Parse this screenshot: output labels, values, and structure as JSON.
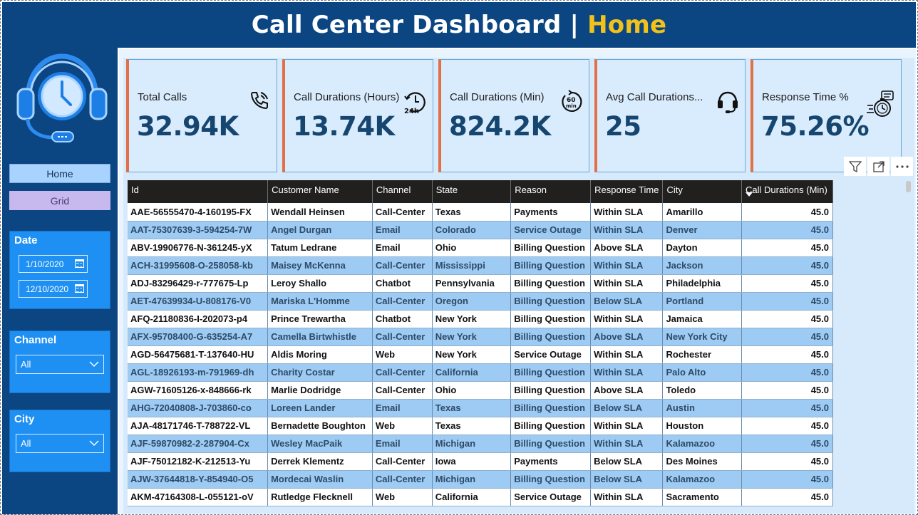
{
  "header": {
    "title": "Call Center Dashboard | ",
    "highlight": "Home"
  },
  "sidebar": {
    "logo_icon": "headset-clock-icon",
    "nav": [
      {
        "label": "Home",
        "active": true
      },
      {
        "label": "Grid",
        "active": false
      }
    ],
    "date_slicer": {
      "label": "Date",
      "start": "1/10/2020",
      "end": "12/10/2020"
    },
    "channel_slicer": {
      "label": "Channel",
      "value": "All"
    },
    "city_slicer": {
      "label": "City",
      "value": "All"
    }
  },
  "kpis": [
    {
      "label": "Total Calls",
      "value": "32.94K",
      "icon": "phone-ringing-icon"
    },
    {
      "label": "Call Durations (Hours)",
      "value": "13.74K",
      "icon": "24h-clock-icon"
    },
    {
      "label": "Call Durations (Min)",
      "value": "824.2K",
      "icon": "60-min-timer-icon"
    },
    {
      "label": "Avg Call Durations...",
      "value": "25",
      "icon": "headset-icon"
    },
    {
      "label": "Response Time %",
      "value": "75.26%",
      "icon": "fast-stopwatch-icon"
    }
  ],
  "toolbar": {
    "icons": [
      "filter-icon",
      "focus-mode-icon",
      "more-options-icon"
    ]
  },
  "colors": {
    "header_bg": "#0b4682",
    "accent": "#f2c21b",
    "card_border": "#e07048",
    "kpi_value": "#16466f"
  },
  "table": {
    "columns": [
      "Id",
      "Customer Name",
      "Channel",
      "State",
      "Reason",
      "Response Time",
      "City",
      "Call Durations (Min)"
    ],
    "sort_column": "Call Durations (Min)",
    "rows": [
      [
        "AAE-56555470-4-160195-FX",
        "Wendall Heinsen",
        "Call-Center",
        "Texas",
        "Payments",
        "Within SLA",
        "Amarillo",
        "45.0"
      ],
      [
        "AAT-75307639-3-594254-7W",
        "Angel Durgan",
        "Email",
        "Colorado",
        "Service Outage",
        "Within SLA",
        "Denver",
        "45.0"
      ],
      [
        "ABV-19906776-N-361245-yX",
        "Tatum Ledrane",
        "Email",
        "Ohio",
        "Billing Question",
        "Above SLA",
        "Dayton",
        "45.0"
      ],
      [
        "ACH-31995608-O-258058-kb",
        "Maisey McKenna",
        "Call-Center",
        "Mississippi",
        "Billing Question",
        "Within SLA",
        "Jackson",
        "45.0"
      ],
      [
        "ADJ-83296429-r-777675-Lp",
        "Leroy Shallo",
        "Chatbot",
        "Pennsylvania",
        "Billing Question",
        "Within SLA",
        "Philadelphia",
        "45.0"
      ],
      [
        "AET-47639934-U-808176-V0",
        "Mariska L'Homme",
        "Call-Center",
        "Oregon",
        "Billing Question",
        "Below SLA",
        "Portland",
        "45.0"
      ],
      [
        "AFQ-21180836-I-202073-p4",
        "Prince Trewartha",
        "Chatbot",
        "New York",
        "Billing Question",
        "Within SLA",
        "Jamaica",
        "45.0"
      ],
      [
        "AFX-95708400-G-635254-A7",
        "Camella Birtwhistle",
        "Call-Center",
        "New York",
        "Billing Question",
        "Above SLA",
        "New York City",
        "45.0"
      ],
      [
        "AGD-56475681-T-137640-HU",
        "Aldis Moring",
        "Web",
        "New York",
        "Service Outage",
        "Within SLA",
        "Rochester",
        "45.0"
      ],
      [
        "AGL-18926193-m-791969-dh",
        "Charity Costar",
        "Call-Center",
        "California",
        "Billing Question",
        "Within SLA",
        "Palo Alto",
        "45.0"
      ],
      [
        "AGW-71605126-x-848666-rk",
        "Marlie Dodridge",
        "Call-Center",
        "Ohio",
        "Billing Question",
        "Above SLA",
        "Toledo",
        "45.0"
      ],
      [
        "AHG-72040808-J-703860-co",
        "Loreen Lander",
        "Email",
        "Texas",
        "Billing Question",
        "Below SLA",
        "Austin",
        "45.0"
      ],
      [
        "AJA-48171746-T-788722-VL",
        "Bernadette Boughton",
        "Web",
        "Texas",
        "Billing Question",
        "Within SLA",
        "Houston",
        "45.0"
      ],
      [
        "AJF-59870982-2-287904-Cx",
        "Wesley MacPaik",
        "Email",
        "Michigan",
        "Billing Question",
        "Within SLA",
        "Kalamazoo",
        "45.0"
      ],
      [
        "AJF-75012182-K-212513-Yu",
        "Derrek Klementz",
        "Call-Center",
        "Iowa",
        "Payments",
        "Below SLA",
        "Des Moines",
        "45.0"
      ],
      [
        "AJW-37644818-Y-854940-O5",
        "Mordecai Waslin",
        "Call-Center",
        "Michigan",
        "Billing Question",
        "Below SLA",
        "Kalamazoo",
        "45.0"
      ],
      [
        "AKM-47164308-L-055121-oV",
        "Rutledge Flecknell",
        "Web",
        "California",
        "Service Outage",
        "Within SLA",
        "Sacramento",
        "45.0"
      ]
    ]
  }
}
